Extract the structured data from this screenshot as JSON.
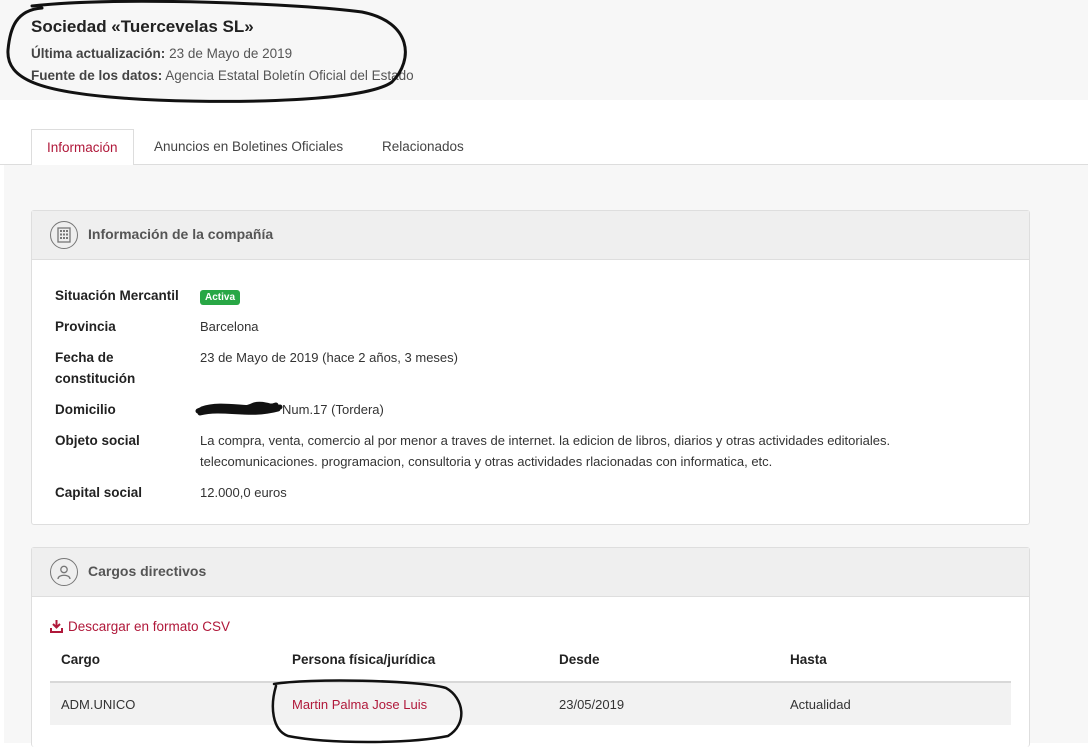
{
  "header": {
    "company_name": "Sociedad «Tuercevelas SL»",
    "updated_label": "Última actualización:",
    "updated_value": "23 de Mayo de 2019",
    "source_label": "Fuente de los datos:",
    "source_value": "Agencia Estatal Boletín Oficial del Estado"
  },
  "tabs": [
    {
      "label": "Información",
      "active": true
    },
    {
      "label": "Anuncios en Boletines Oficiales",
      "active": false
    },
    {
      "label": "Relacionados",
      "active": false
    }
  ],
  "company_panel": {
    "title": "Información de la compañía",
    "icon": "building-icon",
    "rows": {
      "status": {
        "label": "Situación Mercantil",
        "badge": "Activa"
      },
      "province": {
        "label": "Provincia",
        "value": "Barcelona"
      },
      "founded": {
        "label": "Fecha de constitución",
        "value": "23 de Mayo de 2019 (hace 2 años, 3 meses)"
      },
      "address": {
        "label": "Domicilio",
        "value": "Num.17 (Tordera)"
      },
      "purpose": {
        "label": "Objeto social",
        "value": "La compra, venta, comercio al por menor a traves de internet. la edicion de libros, diarios y otras actividades editoriales. telecomunicaciones. programacion, consultoria y otras actividades rlacionadas con informatica, etc."
      },
      "capital": {
        "label": "Capital social",
        "value": "12.000,0 euros"
      }
    }
  },
  "officers_panel": {
    "title": "Cargos directivos",
    "icon": "user-icon",
    "csv_link": "Descargar en formato CSV",
    "columns": [
      "Cargo",
      "Persona física/jurídica",
      "Desde",
      "Hasta"
    ],
    "rows": [
      {
        "cargo": "ADM.UNICO",
        "persona": "Martin Palma Jose Luis",
        "desde": "23/05/2019",
        "hasta": "Actualidad"
      }
    ]
  },
  "colors": {
    "accent": "#b0183a",
    "badge": "#28a745",
    "panel_head": "#efefef",
    "page_bg": "#f7f7f7"
  }
}
